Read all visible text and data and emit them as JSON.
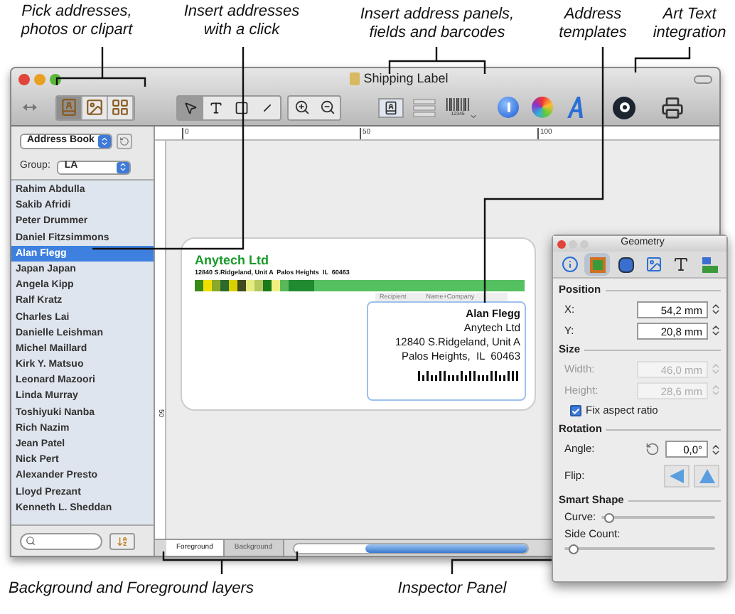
{
  "callouts_top": [
    "Pick addresses, photos or clipart",
    "Insert addresses with a click",
    "Insert address panels, fields and barcodes",
    "Address templates",
    "Art Text integration"
  ],
  "window": {
    "title": "Shipping Label"
  },
  "toolbar": {
    "source_buttons": [
      {
        "kind": "contacts",
        "selected": true
      },
      {
        "kind": "photos",
        "selected": false
      },
      {
        "kind": "clipart",
        "selected": false
      }
    ],
    "barcode_caption": "12345"
  },
  "sidebar": {
    "source": "Address Book",
    "group_label": "Group:",
    "group": "LA",
    "contacts": [
      {
        "name": "Rahim Abdulla",
        "selected": false
      },
      {
        "name": "Sakib Afridi",
        "selected": false
      },
      {
        "name": "Peter Drummer",
        "selected": false
      },
      {
        "name": "Daniel Fitzsimmons",
        "selected": false
      },
      {
        "name": "Alan Flegg",
        "selected": true
      },
      {
        "name": "Japan Japan",
        "selected": false
      },
      {
        "name": "Angela Kipp",
        "selected": false
      },
      {
        "name": "Ralf Kratz",
        "selected": false
      },
      {
        "name": "Charles Lai",
        "selected": false
      },
      {
        "name": "Danielle Leishman",
        "selected": false
      },
      {
        "name": "Michel Maillard",
        "selected": false
      },
      {
        "name": "Kirk Y. Matsuo",
        "selected": false
      },
      {
        "name": "Leonard Mazoori",
        "selected": false
      },
      {
        "name": "Linda Murray",
        "selected": false
      },
      {
        "name": "Toshiyuki Nanba",
        "selected": false
      },
      {
        "name": "Rich Nazim",
        "selected": false
      },
      {
        "name": "Jean Patel",
        "selected": false
      },
      {
        "name": "Nick Pert",
        "selected": false
      },
      {
        "name": "Alexander Presto",
        "selected": false
      },
      {
        "name": "Lloyd Prezant",
        "selected": false
      },
      {
        "name": "Kenneth L. Sheddan",
        "selected": false
      }
    ]
  },
  "ruler": {
    "marks": [
      "0",
      "50",
      "100"
    ],
    "vertical_mark": "50"
  },
  "label": {
    "company": "Anytech Ltd",
    "sender_line": "12840 S.Ridgeland, Unit A  Palos Heights  IL  60463",
    "field_tags": [
      "Recipient",
      "Name+Company"
    ],
    "recipient_lines": [
      "Alan Flegg",
      "Anytech Ltd",
      "12840 S.Ridgeland, Unit A",
      "Palos Heights,  IL  60463"
    ]
  },
  "layer_tabs": [
    {
      "label": "Foreground",
      "selected": true
    },
    {
      "label": "Background",
      "selected": false
    }
  ],
  "inspector": {
    "title": "Geometry",
    "tabs": [
      {
        "kind": "info",
        "selected": false
      },
      {
        "kind": "geometry",
        "selected": true
      },
      {
        "kind": "shapes",
        "selected": false
      },
      {
        "kind": "image",
        "selected": false
      },
      {
        "kind": "text",
        "selected": false
      },
      {
        "kind": "align",
        "selected": false
      }
    ],
    "sections": [
      {
        "title": "Position",
        "rows": [
          {
            "kind": "field",
            "label": "X:",
            "value": "54,2 mm",
            "disabled": false
          },
          {
            "kind": "field",
            "label": "Y:",
            "value": "20,8 mm",
            "disabled": false
          }
        ]
      },
      {
        "title": "Size",
        "rows": [
          {
            "kind": "field",
            "label": "Width:",
            "value": "46,0 mm",
            "disabled": true
          },
          {
            "kind": "field",
            "label": "Height:",
            "value": "28,6 mm",
            "disabled": true
          },
          {
            "kind": "checkbox",
            "label": "Fix aspect ratio",
            "checked": true
          }
        ]
      },
      {
        "title": "Rotation",
        "rows": [
          {
            "kind": "angle",
            "label": "Angle:",
            "value": "0,0°"
          },
          {
            "kind": "flip",
            "label": "Flip:"
          }
        ]
      },
      {
        "title": "Smart Shape",
        "rows": [
          {
            "kind": "slider",
            "label": "Curve:",
            "level": 0.03
          },
          {
            "kind": "slider_below",
            "label": "Side Count:",
            "level": 0.03
          }
        ]
      }
    ]
  },
  "callouts_bottom": [
    "Background and Foreground layers",
    "Inspector Panel"
  ]
}
